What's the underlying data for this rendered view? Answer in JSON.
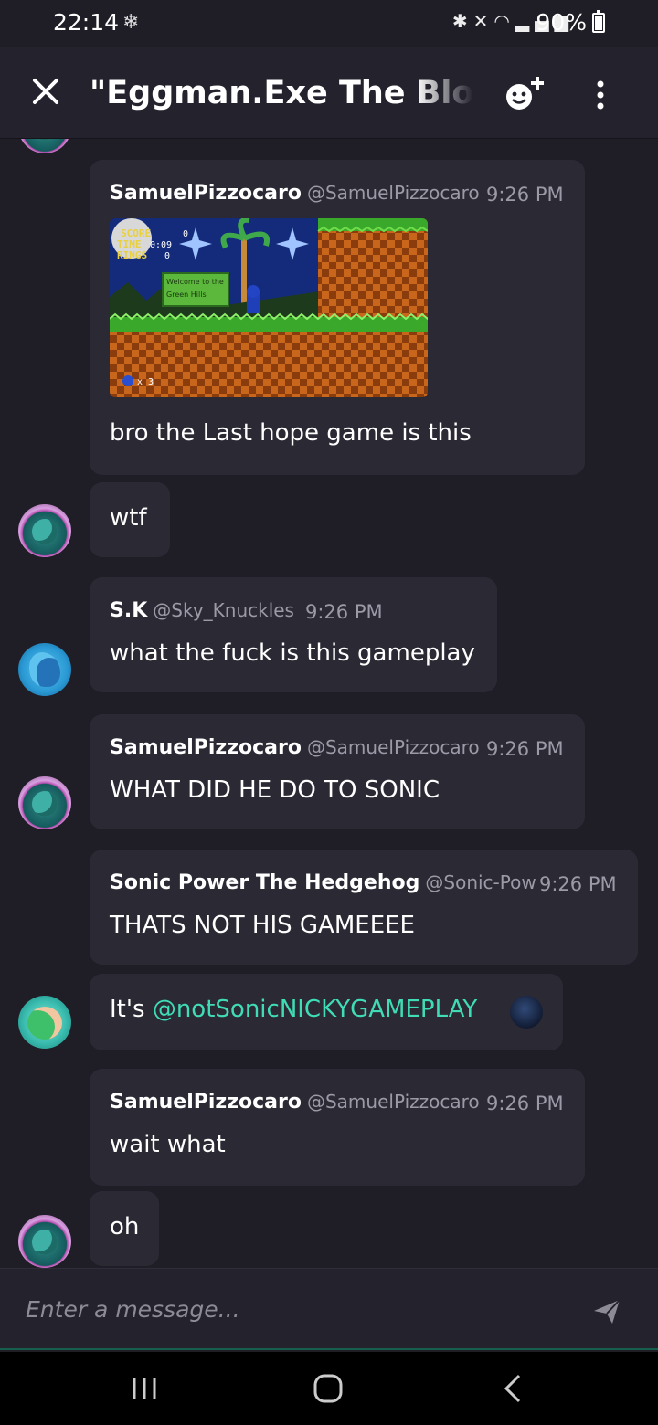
{
  "status_bar": {
    "time": "22:14",
    "battery": "90%",
    "icons": [
      "bluetooth-icon",
      "mute-icon",
      "wifi-icon",
      "volte-icon",
      "signal-icon",
      "battery-icon"
    ]
  },
  "header": {
    "title": "\"Eggman.Exe  The Blood"
  },
  "messages": [
    {
      "author": "SamuelPizzocaro",
      "handle": "@SamuelPizzocaro",
      "time": "9:26 PM",
      "text": "bro the Last hope game is this",
      "game_image": {
        "hud_score": "SCORE",
        "hud_time": "TIME",
        "hud_rings": "RINGS",
        "score_val": "0",
        "time_val": "0:09",
        "rings_val": "0",
        "sign_line1": "Welcome to the",
        "sign_line2": "Green Hills",
        "lives": "x 3"
      }
    },
    {
      "text": "wtf"
    },
    {
      "author": "S.K",
      "handle": "@Sky_Knuckles",
      "time": "9:26 PM",
      "text": "what the fuck is this gameplay"
    },
    {
      "author": "SamuelPizzocaro",
      "handle": "@SamuelPizzocaro",
      "time": "9:26 PM",
      "text": "WHAT DID HE DO TO SONIC"
    },
    {
      "author": "Sonic Power The Hedgehog",
      "handle": "@Sonic-Pow",
      "time": "9:26 PM",
      "text": "THATS NOT HIS GAMEEEE"
    },
    {
      "text_prefix": "It's ",
      "mention": "@notSonicNICKYGAMEPLAY"
    },
    {
      "author": "SamuelPizzocaro",
      "handle": "@SamuelPizzocaro",
      "time": "9:26 PM",
      "text": "wait what"
    },
    {
      "text": "oh"
    }
  ],
  "composer": {
    "placeholder": "Enter a message..."
  },
  "colors": {
    "background": "#1f1d26",
    "bubble": "#2b2934",
    "mention": "#3fdcb5",
    "muted": "#9c9aa6"
  }
}
